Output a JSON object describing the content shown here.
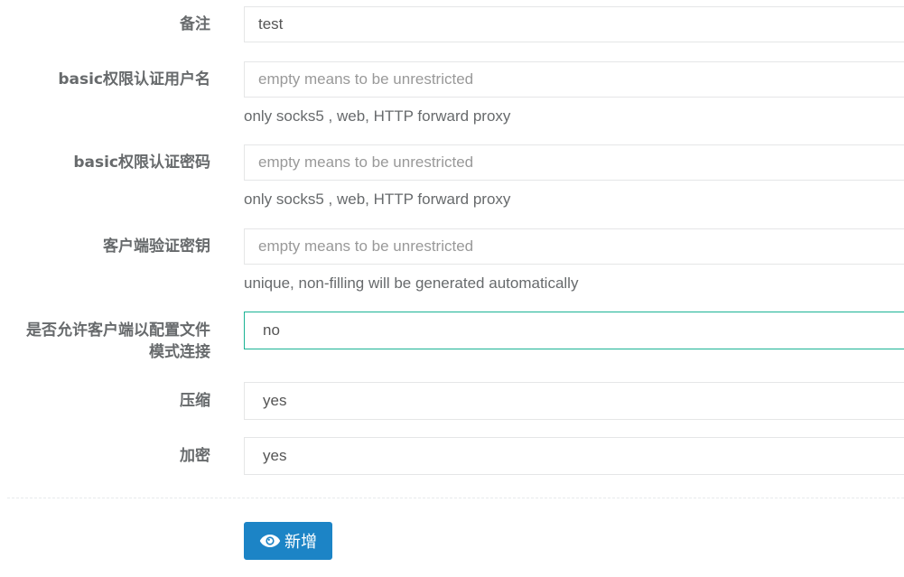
{
  "form": {
    "remark": {
      "label": "备注",
      "value": "test"
    },
    "basic_username": {
      "label": "basic权限认证用户名",
      "placeholder": "empty means to be unrestricted",
      "help": "only socks5 , web, HTTP forward proxy"
    },
    "basic_password": {
      "label": "basic权限认证密码",
      "placeholder": "empty means to be unrestricted",
      "help": "only socks5 , web, HTTP forward proxy"
    },
    "client_key": {
      "label": "客户端验证密钥",
      "placeholder": "empty means to be unrestricted",
      "help": "unique, non-filling will be generated automatically"
    },
    "config_mode": {
      "label_line1": "是否允许客户端以配置文件",
      "label_line2": "模式连接",
      "value": "no"
    },
    "compress": {
      "label": "压缩",
      "value": "yes"
    },
    "encrypt": {
      "label": "加密",
      "value": "yes"
    }
  },
  "actions": {
    "add_label": "新增",
    "add_icon": "eye-icon"
  },
  "colors": {
    "primary_button": "#1c84c6",
    "focus_border": "#1ab394",
    "label_text": "#676a6c",
    "border": "#e5e6e7"
  }
}
